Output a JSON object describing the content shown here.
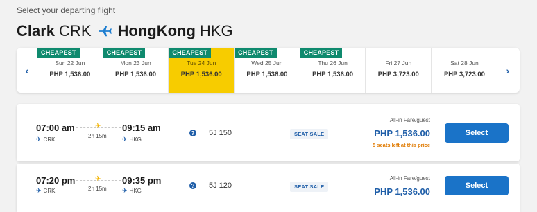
{
  "header": {
    "page_label": "Select your departing flight",
    "origin_city": "Clark",
    "origin_code": "CRK",
    "destination_city": "HongKong",
    "destination_code": "HKG"
  },
  "date_strip": {
    "prev_icon": "chevron-left-icon",
    "next_icon": "chevron-right-icon",
    "dates": [
      {
        "tag": "CHEAPEST",
        "day": "Sun 22 Jun",
        "price": "PHP 1,536.00",
        "selected": false
      },
      {
        "tag": "CHEAPEST",
        "day": "Mon 23 Jun",
        "price": "PHP 1,536.00",
        "selected": false
      },
      {
        "tag": "CHEAPEST",
        "day": "Tue 24 Jun",
        "price": "PHP 1,536.00",
        "selected": true
      },
      {
        "tag": "CHEAPEST",
        "day": "Wed 25 Jun",
        "price": "PHP 1,536.00",
        "selected": false
      },
      {
        "tag": "CHEAPEST",
        "day": "Thu 26 Jun",
        "price": "PHP 1,536.00",
        "selected": false
      },
      {
        "tag": "",
        "day": "Fri 27 Jun",
        "price": "PHP 3,723.00",
        "selected": false
      },
      {
        "tag": "",
        "day": "Sat 28 Jun",
        "price": "PHP 3,723.00",
        "selected": false
      }
    ]
  },
  "flights": [
    {
      "depart_time": "07:00 am",
      "depart_code": "CRK",
      "arrive_time": "09:15 am",
      "arrive_code": "HKG",
      "duration": "2h 15m",
      "flight_no": "5J 150",
      "badge": "SEAT SALE",
      "fare_label": "All-in Fare/guest",
      "fare": "PHP 1,536.00",
      "seats_left": "5 seats left at this price",
      "select_label": "Select"
    },
    {
      "depart_time": "07:20 pm",
      "depart_code": "CRK",
      "arrive_time": "09:35 pm",
      "arrive_code": "HKG",
      "duration": "2h 15m",
      "flight_no": "5J 120",
      "badge": "SEAT SALE",
      "fare_label": "All-in Fare/guest",
      "fare": "PHP 1,536.00",
      "select_label": "Select"
    }
  ],
  "colors": {
    "accent_blue": "#1f5ea8",
    "button_blue": "#1a73c8",
    "selected_yellow": "#f7cc00",
    "cheapest_green": "#0f8a6e",
    "warning_orange": "#e07a00"
  }
}
